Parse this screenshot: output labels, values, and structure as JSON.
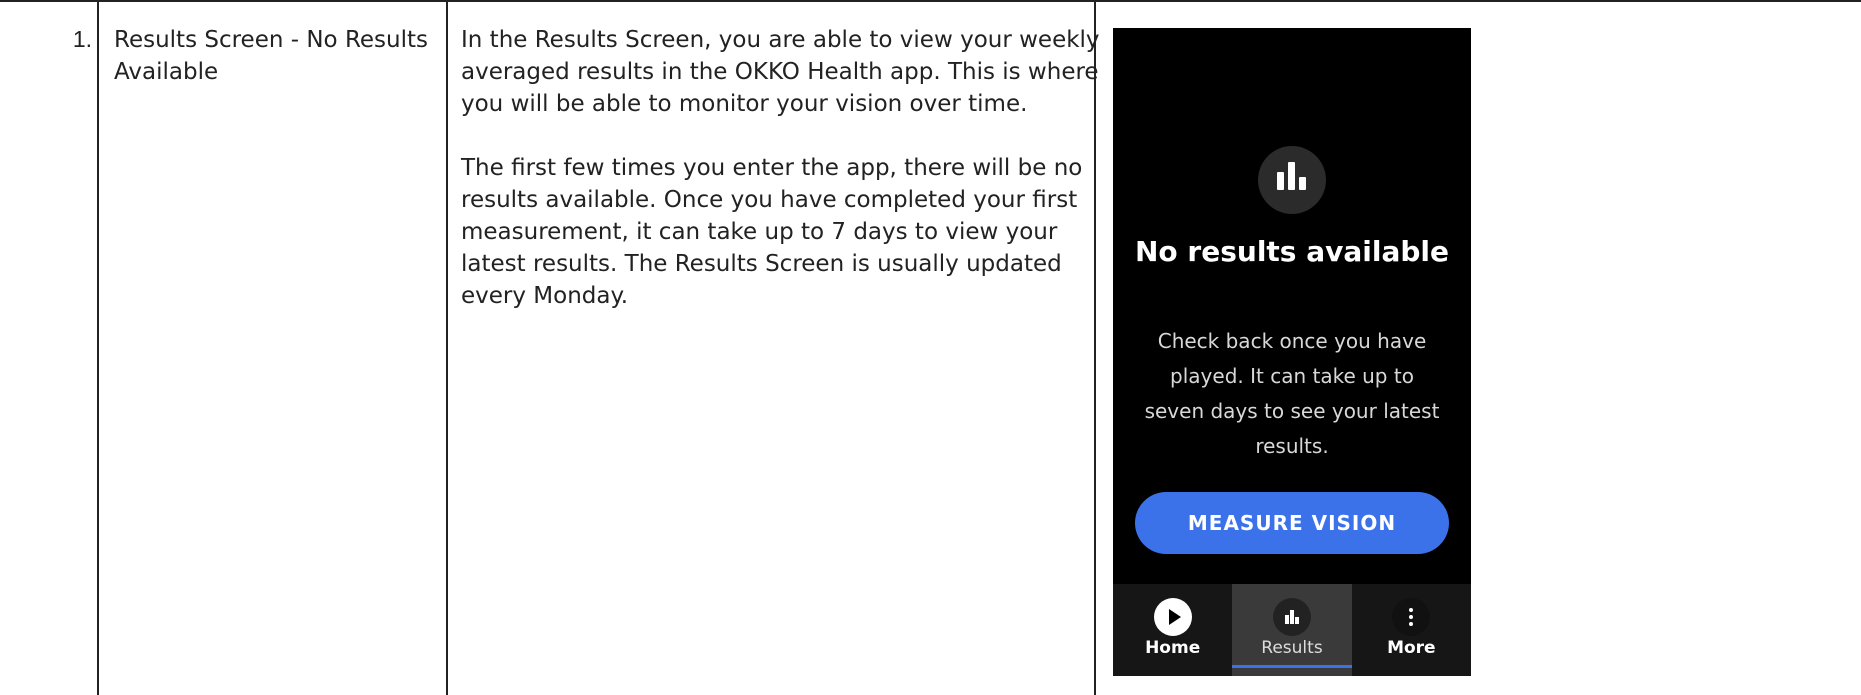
{
  "row": {
    "number": "1.",
    "title": "Results Screen - No Results Available",
    "description": [
      "In the Results Screen, you are able to view your weekly averaged results in the OKKO Health app. This is where you will be able to monitor your vision over time.",
      "The first few times you enter the app, there will be no results available. Once you have completed your first measurement, it can take up to 7 days to view your latest results. The Results Screen is usually updated every Monday."
    ]
  },
  "phone": {
    "empty_icon": "bar-chart-icon",
    "title": "No results available",
    "body": "Check back once you have played. It can take up to seven days to see your latest results.",
    "button_label": "MEASURE VISION",
    "accent_color": "#3b72ea",
    "nav": [
      {
        "label": "Home",
        "icon": "play-icon"
      },
      {
        "label": "Results",
        "icon": "bar-chart-icon",
        "active": true
      },
      {
        "label": "More",
        "icon": "more-vertical-icon"
      }
    ]
  }
}
